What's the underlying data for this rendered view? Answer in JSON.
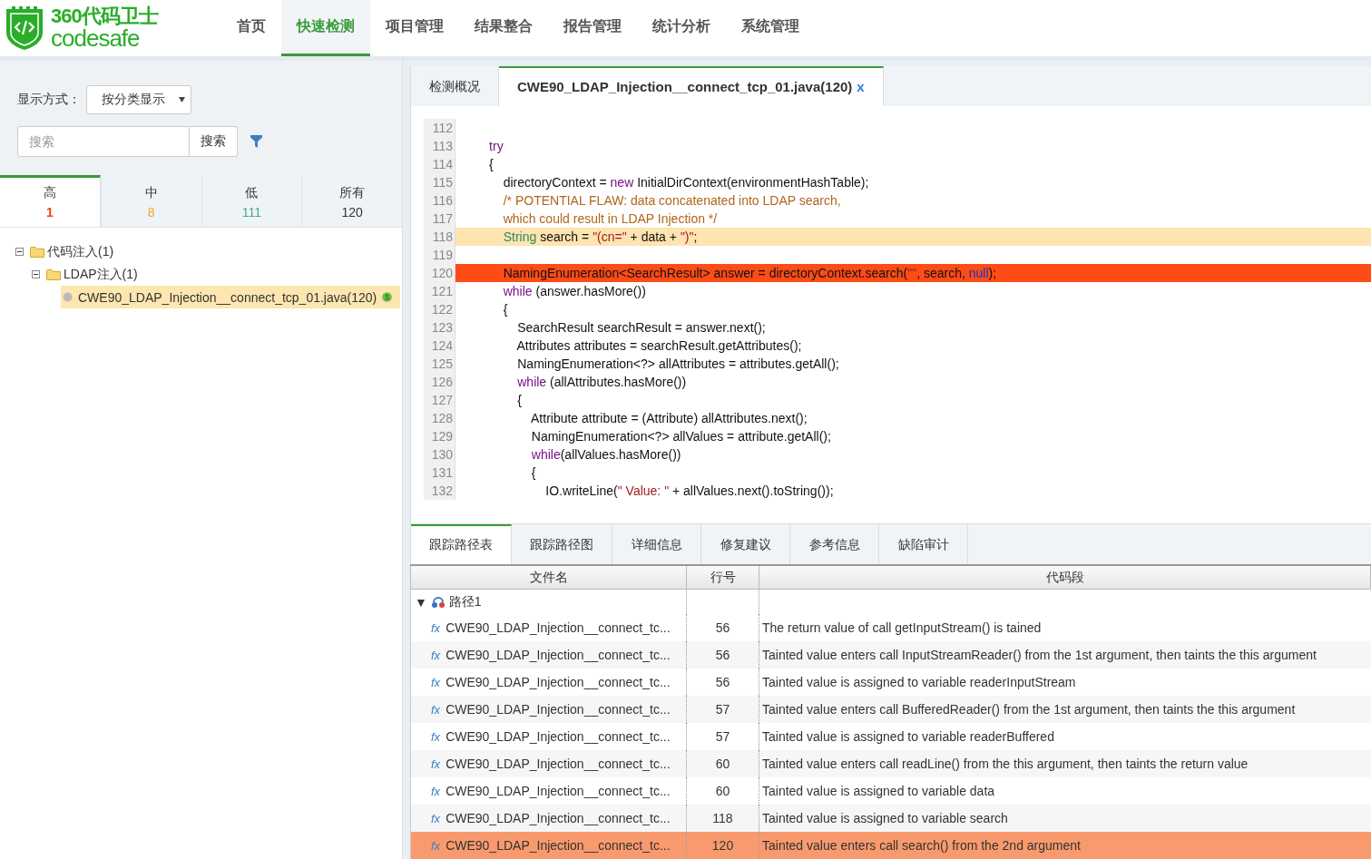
{
  "header": {
    "logo": {
      "title": "360代码卫士",
      "subtitle": "codesafe"
    },
    "nav": [
      {
        "label": "首页",
        "selected": false
      },
      {
        "label": "快速检测",
        "selected": true
      },
      {
        "label": "项目管理",
        "selected": false
      },
      {
        "label": "结果整合",
        "selected": false
      },
      {
        "label": "报告管理",
        "selected": false
      },
      {
        "label": "统计分析",
        "selected": false
      },
      {
        "label": "系统管理",
        "selected": false
      }
    ]
  },
  "sidebar": {
    "display_mode": {
      "label": "显示方式：",
      "value": "按分类显示"
    },
    "search": {
      "placeholder": "搜索",
      "button": "搜索"
    },
    "severity_tabs": [
      {
        "label": "高",
        "count": "1",
        "color": "#f0400c",
        "selected": true
      },
      {
        "label": "中",
        "count": "8",
        "color": "#f5a623",
        "selected": false
      },
      {
        "label": "低",
        "count": "111",
        "color": "#4aa88a",
        "selected": false
      },
      {
        "label": "所有",
        "count": "120",
        "color": "#333333",
        "selected": false
      }
    ],
    "tree": [
      {
        "label": "代码注入(1)",
        "expanded": true,
        "children": [
          {
            "label": "LDAP注入(1)",
            "expanded": true,
            "children": [
              {
                "label": "CWE90_LDAP_Injection__connect_tcp_01.java(120)",
                "selected": true
              }
            ]
          }
        ]
      }
    ]
  },
  "editor": {
    "tabs": [
      {
        "label": "检测概况",
        "selected": false,
        "closable": false
      },
      {
        "label": "CWE90_LDAP_Injection__connect_tcp_01.java(120)",
        "selected": true,
        "closable": true,
        "close": "x"
      }
    ],
    "lines": [
      {
        "number": "112",
        "kind": "plain"
      },
      {
        "number": "113",
        "kind": "plain",
        "tokens": [
          {
            "kind": "keyword",
            "text": "        try"
          }
        ]
      },
      {
        "number": "114",
        "kind": "plain",
        "tokens": [
          {
            "kind": "plain",
            "text": "        {"
          }
        ]
      },
      {
        "number": "115",
        "kind": "plain",
        "tokens": [
          {
            "kind": "plain",
            "text": "            directoryContext = "
          },
          {
            "kind": "keyword",
            "text": "new"
          },
          {
            "kind": "plain",
            "text": " InitialDirContext(environmentHashTable);"
          }
        ]
      },
      {
        "number": "116",
        "kind": "plain",
        "tokens": [
          {
            "kind": "comment",
            "text": "            /* POTENTIAL FLAW: data concatenated into LDAP search,"
          }
        ]
      },
      {
        "number": "117",
        "kind": "plain",
        "tokens": [
          {
            "kind": "comment",
            "text": "            which could result in LDAP Injection */"
          }
        ]
      },
      {
        "number": "118",
        "kind": "trace",
        "tokens": [
          {
            "kind": "type",
            "text": "            String"
          },
          {
            "kind": "plain",
            "text": " search = "
          },
          {
            "kind": "string",
            "text": "\"(cn=\""
          },
          {
            "kind": "plain",
            "text": " + data + "
          },
          {
            "kind": "string",
            "text": "\")\""
          },
          {
            "kind": "plain",
            "text": ";"
          }
        ]
      },
      {
        "number": "119",
        "kind": "plain"
      },
      {
        "number": "120",
        "kind": "defect",
        "tokens": [
          {
            "kind": "plain",
            "text": "            NamingEnumeration<SearchResult> answer = directoryContext.search("
          },
          {
            "kind": "string",
            "text": "\"\""
          },
          {
            "kind": "plain",
            "text": ", search, "
          },
          {
            "kind": "literal",
            "text": "null"
          },
          {
            "kind": "plain",
            "text": ");"
          }
        ]
      },
      {
        "number": "121",
        "kind": "plain",
        "tokens": [
          {
            "kind": "keyword",
            "text": "            while"
          },
          {
            "kind": "plain",
            "text": " (answer.hasMore())"
          }
        ]
      },
      {
        "number": "122",
        "kind": "plain",
        "tokens": [
          {
            "kind": "plain",
            "text": "            {"
          }
        ]
      },
      {
        "number": "123",
        "kind": "plain",
        "tokens": [
          {
            "kind": "plain",
            "text": "                SearchResult searchResult = answer.next();"
          }
        ]
      },
      {
        "number": "124",
        "kind": "plain",
        "tokens": [
          {
            "kind": "plain",
            "text": "                Attributes attributes = searchResult.getAttributes();"
          }
        ]
      },
      {
        "number": "125",
        "kind": "plain",
        "tokens": [
          {
            "kind": "plain",
            "text": "                NamingEnumeration<?> allAttributes = attributes.getAll();"
          }
        ]
      },
      {
        "number": "126",
        "kind": "plain",
        "tokens": [
          {
            "kind": "keyword",
            "text": "                while"
          },
          {
            "kind": "plain",
            "text": " (allAttributes.hasMore())"
          }
        ]
      },
      {
        "number": "127",
        "kind": "plain",
        "tokens": [
          {
            "kind": "plain",
            "text": "                {"
          }
        ]
      },
      {
        "number": "128",
        "kind": "plain",
        "tokens": [
          {
            "kind": "plain",
            "text": "                    Attribute attribute = (Attribute) allAttributes.next();"
          }
        ]
      },
      {
        "number": "129",
        "kind": "plain",
        "tokens": [
          {
            "kind": "plain",
            "text": "                    NamingEnumeration<?> allValues = attribute.getAll();"
          }
        ]
      },
      {
        "number": "130",
        "kind": "plain",
        "tokens": [
          {
            "kind": "keyword",
            "text": "                    while"
          },
          {
            "kind": "plain",
            "text": "(allValues.hasMore())"
          }
        ]
      },
      {
        "number": "131",
        "kind": "plain",
        "tokens": [
          {
            "kind": "plain",
            "text": "                    {"
          }
        ]
      },
      {
        "number": "132",
        "kind": "plain",
        "tokens": [
          {
            "kind": "plain",
            "text": "                        IO.writeLine("
          },
          {
            "kind": "string",
            "text": "\" Value: \""
          },
          {
            "kind": "plain",
            "text": " + allValues.next().toString());"
          }
        ]
      }
    ]
  },
  "detail": {
    "tabs": [
      {
        "label": "跟踪路径表",
        "selected": true
      },
      {
        "label": "跟踪路径图",
        "selected": false
      },
      {
        "label": "详细信息",
        "selected": false
      },
      {
        "label": "修复建议",
        "selected": false
      },
      {
        "label": "参考信息",
        "selected": false
      },
      {
        "label": "缺陷审计",
        "selected": false
      }
    ],
    "columns": [
      "文件名",
      "行号",
      "代码段"
    ],
    "paths": [
      {
        "label": "路径1",
        "toggle": "▼",
        "expanded": true,
        "rows": [
          {
            "icon": "fx",
            "file": "CWE90_LDAP_Injection__connect_tc...",
            "line": "56",
            "code": "The return value of call getInputStream() is tained",
            "selected": false
          },
          {
            "icon": "fx",
            "file": "CWE90_LDAP_Injection__connect_tc...",
            "line": "56",
            "code": "Tainted value enters call InputStreamReader() from the 1st argument, then taints the this argument",
            "selected": false
          },
          {
            "icon": "fx",
            "file": "CWE90_LDAP_Injection__connect_tc...",
            "line": "56",
            "code": "Tainted value is assigned to variable readerInputStream",
            "selected": false
          },
          {
            "icon": "fx",
            "file": "CWE90_LDAP_Injection__connect_tc...",
            "line": "57",
            "code": "Tainted value enters call BufferedReader() from the 1st argument, then taints the this argument",
            "selected": false
          },
          {
            "icon": "fx",
            "file": "CWE90_LDAP_Injection__connect_tc...",
            "line": "57",
            "code": "Tainted value is assigned to variable readerBuffered",
            "selected": false
          },
          {
            "icon": "fx",
            "file": "CWE90_LDAP_Injection__connect_tc...",
            "line": "60",
            "code": "Tainted value enters call readLine() from the this argument, then taints the return value",
            "selected": false
          },
          {
            "icon": "fx",
            "file": "CWE90_LDAP_Injection__connect_tc...",
            "line": "60",
            "code": "Tainted value is assigned to variable data",
            "selected": false
          },
          {
            "icon": "fx",
            "file": "CWE90_LDAP_Injection__connect_tc...",
            "line": "118",
            "code": "Tainted value is assigned to variable search",
            "selected": false
          },
          {
            "icon": "fx",
            "file": "CWE90_LDAP_Injection__connect_tc...",
            "line": "120",
            "code": "Tainted value enters call search() from the 2nd argument",
            "selected": true
          }
        ]
      }
    ]
  }
}
